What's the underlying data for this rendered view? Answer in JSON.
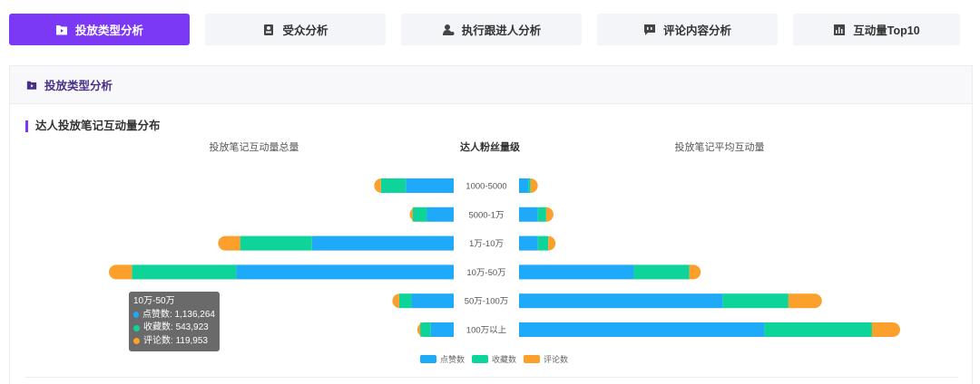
{
  "tabs": [
    {
      "label": "投放类型分析",
      "icon": "folder-icon",
      "active": true
    },
    {
      "label": "受众分析",
      "icon": "profile-card-icon",
      "active": false
    },
    {
      "label": "执行跟进人分析",
      "icon": "person-icon",
      "active": false
    },
    {
      "label": "评论内容分析",
      "icon": "comment-icon",
      "active": false
    },
    {
      "label": "互动量Top10",
      "icon": "bar-chart-icon",
      "active": false
    }
  ],
  "panel": {
    "title": "投放类型分析",
    "icon": "folder-icon"
  },
  "section_title": "达人投放笔记互动量分布",
  "column_headers": {
    "left": "投放笔记互动量总量",
    "middle": "达人粉丝量级",
    "right": "投放笔记平均互动量"
  },
  "colors": {
    "accent": "#7b39f5",
    "likes": "#1eaaf8",
    "favorites": "#0fd49a",
    "comments": "#fba02c"
  },
  "tooltip": {
    "title": "10万-50万",
    "rows": [
      {
        "label": "点赞数",
        "value": "1,136,264",
        "color": "#1eaaf8"
      },
      {
        "label": "收藏数",
        "value": "543,923",
        "color": "#0fd49a"
      },
      {
        "label": "评论数",
        "value": "119,953",
        "color": "#fba02c"
      }
    ]
  },
  "chart_data": {
    "type": "bar",
    "orientation": "horizontal-butterfly",
    "categories": [
      "1000-5000",
      "5000-1万",
      "1万-10万",
      "10万-50万",
      "50万-100万",
      "100万以上"
    ],
    "left_panel": {
      "title": "投放笔记互动量总量",
      "stacked": true,
      "series": [
        {
          "name": "点赞数",
          "values": [
            250000,
            140000,
            740000,
            1136264,
            220000,
            120000
          ]
        },
        {
          "name": "收藏数",
          "values": [
            130000,
            75000,
            375000,
            543923,
            65000,
            55000
          ]
        },
        {
          "name": "评论数",
          "values": [
            35000,
            15000,
            115000,
            119953,
            35000,
            15000
          ]
        }
      ]
    },
    "right_panel": {
      "title": "投放笔记平均互动量",
      "stacked": true,
      "series": [
        {
          "name": "点赞数",
          "values": [
            9,
            18,
            18,
            110,
            195,
            235
          ]
        },
        {
          "name": "收藏数",
          "values": [
            2,
            8,
            10,
            53,
            63,
            103
          ]
        },
        {
          "name": "评论数",
          "values": [
            2,
            2,
            2,
            11,
            32,
            27
          ]
        }
      ]
    },
    "legend": [
      "点赞数",
      "收藏数",
      "评论数"
    ],
    "legend_position": "bottom-center"
  }
}
